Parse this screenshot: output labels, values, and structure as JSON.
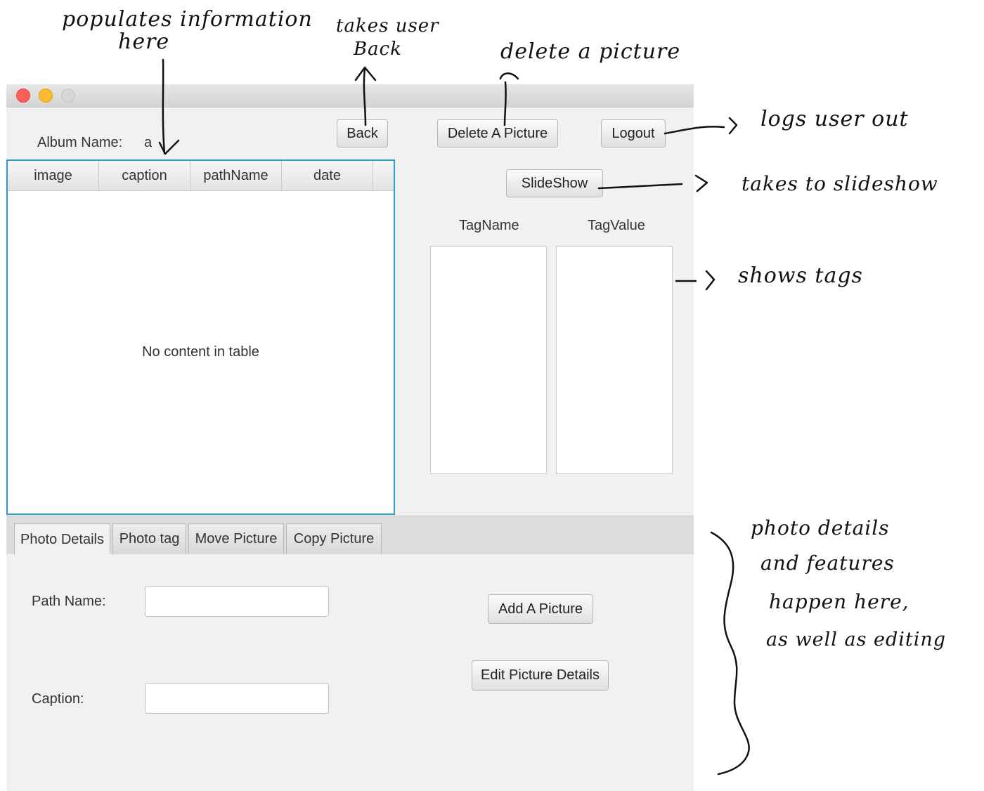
{
  "album": {
    "label": "Album Name:",
    "value": "a"
  },
  "buttons": {
    "back": "Back",
    "delete": "Delete A Picture",
    "logout": "Logout",
    "slideshow": "SlideShow",
    "add": "Add A Picture",
    "edit": "Edit Picture Details"
  },
  "table": {
    "columns": [
      "image",
      "caption",
      "pathName",
      "date"
    ],
    "empty_text": "No content in table"
  },
  "tags": {
    "name_header": "TagName",
    "value_header": "TagValue"
  },
  "tabs": [
    "Photo Details",
    "Photo tag",
    "Move Picture",
    "Copy Picture"
  ],
  "form": {
    "path_label": "Path Name:",
    "caption_label": "Caption:"
  },
  "annotations": {
    "populates": [
      "populates information",
      "here"
    ],
    "back": [
      "takes user",
      "Back"
    ],
    "delete": "delete a picture",
    "logout": "logs user out",
    "slideshow": "takes to slideshow",
    "tags": "shows tags",
    "details": [
      "photo details",
      "and features",
      "happen here,",
      "as well as editing"
    ]
  }
}
